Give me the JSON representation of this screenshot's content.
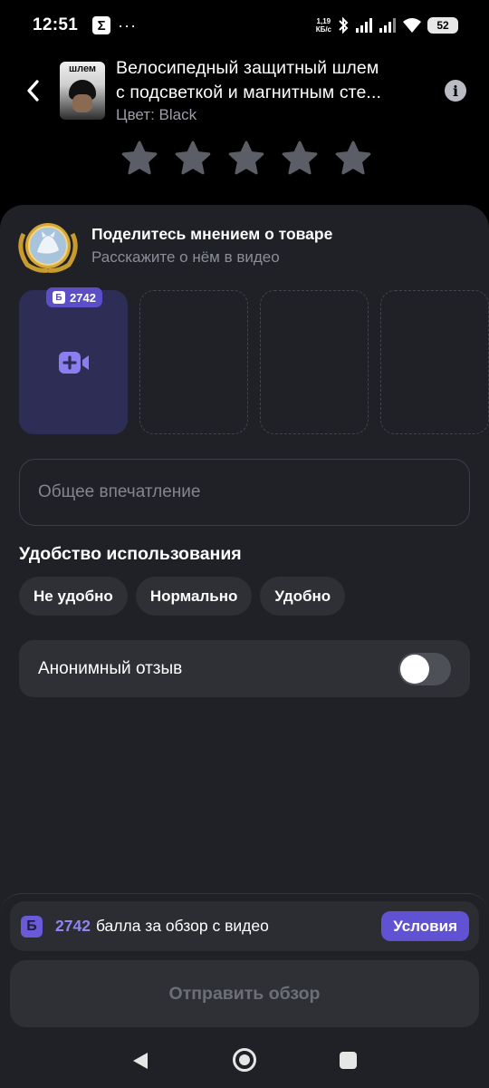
{
  "status_bar": {
    "time": "12:51",
    "app_icon": "Σ",
    "more_dots": "···",
    "net_speed_value": "1,19",
    "net_speed_unit": "КБ/с",
    "battery": "52",
    "icons": [
      "bluetooth-icon",
      "signal-icon",
      "signal-icon",
      "wifi-icon",
      "battery-icon"
    ]
  },
  "header": {
    "thumb_text": "шлем",
    "title_line1": "Велосипедный защитный шлем",
    "title_line2": "с подсветкой и магнитным сте...",
    "color_label": "Цвет: Black",
    "info_icon": "i"
  },
  "rating": {
    "stars_total": 5,
    "stars_filled": 0
  },
  "share": {
    "title": "Поделитесь мнением о товаре",
    "subtitle": "Расскажите о нём в видео"
  },
  "video": {
    "points_badge_icon": "Б",
    "points_badge": "2742"
  },
  "impression": {
    "placeholder": "Общее впечатление",
    "value": ""
  },
  "usability": {
    "title": "Удобство использования",
    "options": [
      "Не удобно",
      "Нормально",
      "Удобно"
    ]
  },
  "anonymous": {
    "label": "Анонимный отзыв",
    "enabled": false
  },
  "bonus": {
    "icon": "Б",
    "points": "2742",
    "text": "балла за обзор с видео",
    "conditions_label": "Условия"
  },
  "submit_label": "Отправить обзор",
  "colors": {
    "background": "#000000",
    "card": "#1f2126",
    "accent": "#6151d3",
    "video_slot": "#2e2d55",
    "chip": "#2e3035"
  }
}
